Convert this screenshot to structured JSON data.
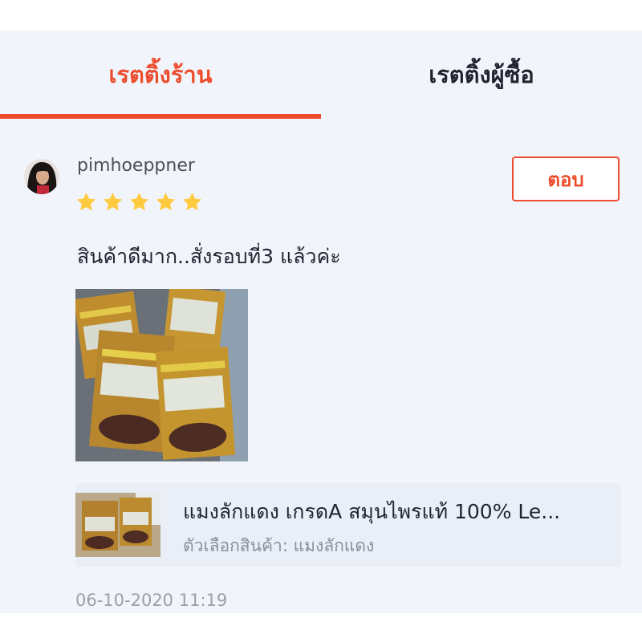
{
  "tabs": {
    "store_rating": "เรตติ้งร้าน",
    "buyer_rating": "เรตติ้งผู้ซื้อ",
    "active": "store_rating"
  },
  "review": {
    "username": "pimhoeppner",
    "rating": 5,
    "reply_label": "ตอบ",
    "comment": "สินค้าดีมาก..สั่งรอบที่3 แล้วค่ะ",
    "product": {
      "name": "แมงลักแดง เกรดA สมุนไพรแท้ 100% Le...",
      "variant": "ตัวเลือกสินค้า: แมงลักแดง"
    },
    "timestamp": "06-10-2020 11:19"
  },
  "colors": {
    "accent": "#ee4d2d",
    "star": "#ffc940",
    "background": "#f1f5fb"
  }
}
